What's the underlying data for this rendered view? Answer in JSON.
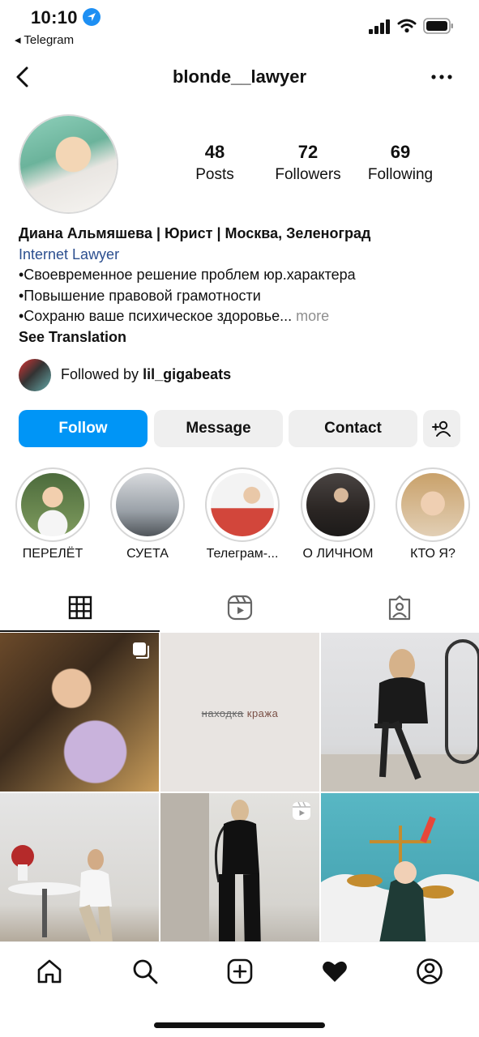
{
  "status": {
    "time": "10:10",
    "back_app": "◂ Telegram"
  },
  "header": {
    "username": "blonde__lawyer"
  },
  "stats": {
    "posts_num": "48",
    "posts_label": "Posts",
    "followers_num": "72",
    "followers_label": "Followers",
    "following_num": "69",
    "following_label": "Following"
  },
  "bio": {
    "name": "Диана Альмяшева | Юрист | Москва, Зеленоград",
    "category": "Internet Lawyer",
    "line1": "•Своевременное решение проблем юр.характера",
    "line2": "•Повышение правовой грамотности",
    "line3": "•Сохраню ваше психическое здоровье...",
    "more": "more",
    "see_translation": "See Translation"
  },
  "followed": {
    "prefix": "Followed by ",
    "user": "lil_gigabeats"
  },
  "buttons": {
    "follow": "Follow",
    "message": "Message",
    "contact": "Contact"
  },
  "highlights": [
    {
      "label": "ПЕРЕЛЁТ"
    },
    {
      "label": "СУЕТА"
    },
    {
      "label": "Телеграм-..."
    },
    {
      "label": "О ЛИЧНОМ"
    },
    {
      "label": "КТО Я?"
    }
  ],
  "grid": {
    "tile2_strike": "находка",
    "tile2_word": " кража"
  },
  "colors": {
    "accent": "#0095f6",
    "secondary_button": "#efefef",
    "category_link": "#2c4f8f"
  }
}
